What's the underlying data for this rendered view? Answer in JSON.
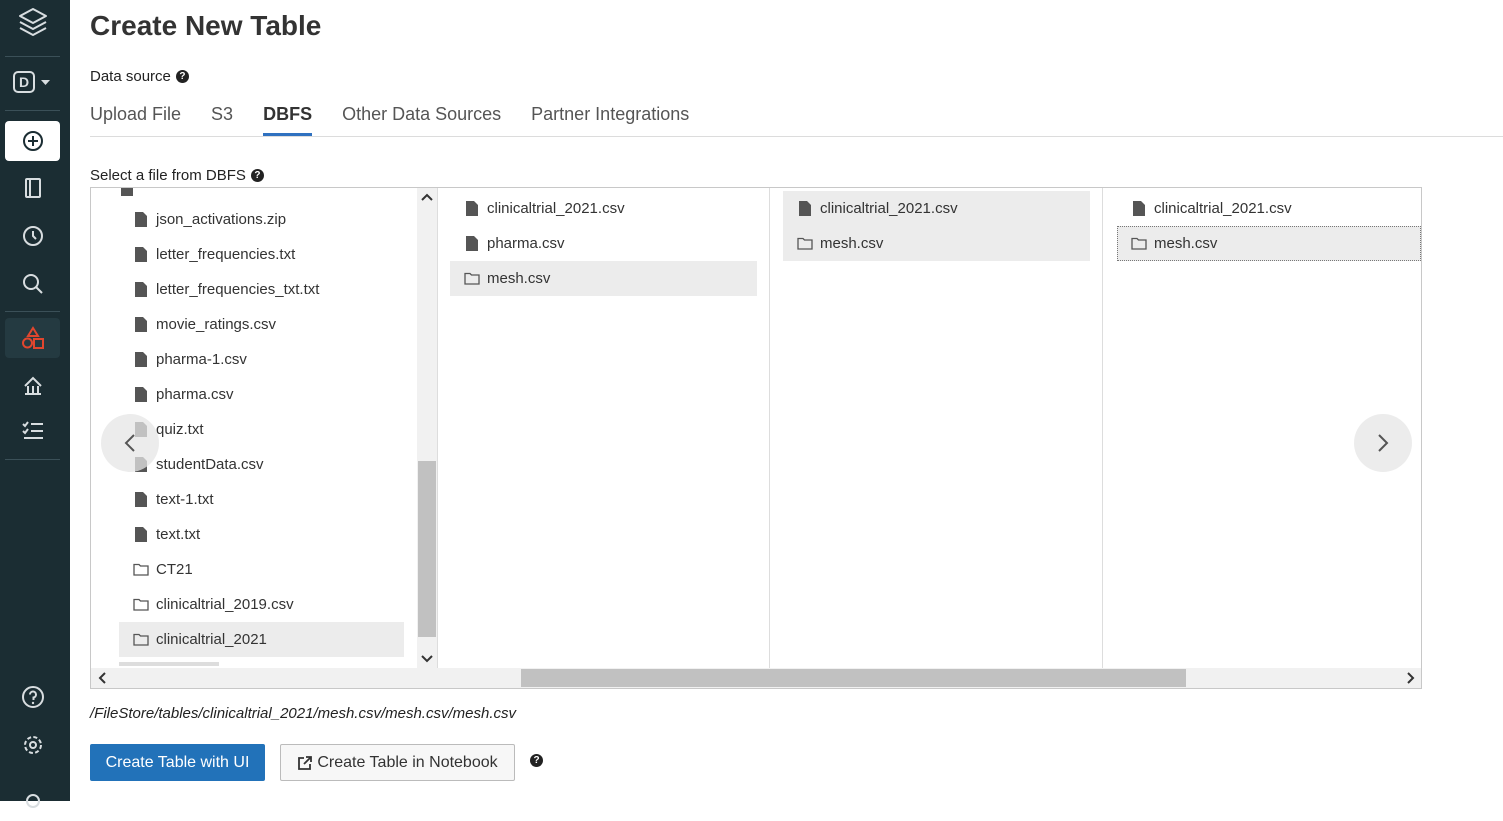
{
  "page": {
    "title": "Create New Table",
    "data_source_label": "Data source",
    "select_label": "Select a file from DBFS",
    "help_glyph": "?"
  },
  "sidebar": {
    "workspace_letter": "D"
  },
  "tabs": [
    {
      "label": "Upload File"
    },
    {
      "label": "S3"
    },
    {
      "label": "DBFS",
      "active": true
    },
    {
      "label": "Other Data Sources"
    },
    {
      "label": "Partner Integrations"
    }
  ],
  "columns": {
    "col1": [
      {
        "name": "json_activations.zip",
        "type": "file"
      },
      {
        "name": "letter_frequencies.txt",
        "type": "file"
      },
      {
        "name": "letter_frequencies_txt.txt",
        "type": "file"
      },
      {
        "name": "movie_ratings.csv",
        "type": "file"
      },
      {
        "name": "pharma-1.csv",
        "type": "file"
      },
      {
        "name": "pharma.csv",
        "type": "file"
      },
      {
        "name": "quiz.txt",
        "type": "file"
      },
      {
        "name": "studentData.csv",
        "type": "file"
      },
      {
        "name": "text-1.txt",
        "type": "file"
      },
      {
        "name": "text.txt",
        "type": "file"
      },
      {
        "name": "CT21",
        "type": "folder"
      },
      {
        "name": "clinicaltrial_2019.csv",
        "type": "folder"
      },
      {
        "name": "clinicaltrial_2021",
        "type": "folder",
        "selected": true
      }
    ],
    "col2": [
      {
        "name": "clinicaltrial_2021.csv",
        "type": "file"
      },
      {
        "name": "pharma.csv",
        "type": "file"
      },
      {
        "name": "mesh.csv",
        "type": "folder",
        "selected": true
      }
    ],
    "col3": [
      {
        "name": "clinicaltrial_2021.csv",
        "type": "file",
        "selected": true
      },
      {
        "name": "mesh.csv",
        "type": "folder",
        "selected": true
      }
    ],
    "col4": [
      {
        "name": "clinicaltrial_2021.csv",
        "type": "file"
      },
      {
        "name": "mesh.csv",
        "type": "folder",
        "selected": true,
        "focused": true
      }
    ]
  },
  "path": "/FileStore/tables/clinicaltrial_2021/mesh.csv/mesh.csv/mesh.csv",
  "buttons": {
    "create_ui": "Create Table with UI",
    "create_notebook": "Create Table in Notebook"
  },
  "colors": {
    "sidebar_bg": "#1b2d33",
    "primary_button": "#2272b9",
    "tab_underline": "#2f71c0",
    "sidebar_active_icon": "#e0462e"
  }
}
